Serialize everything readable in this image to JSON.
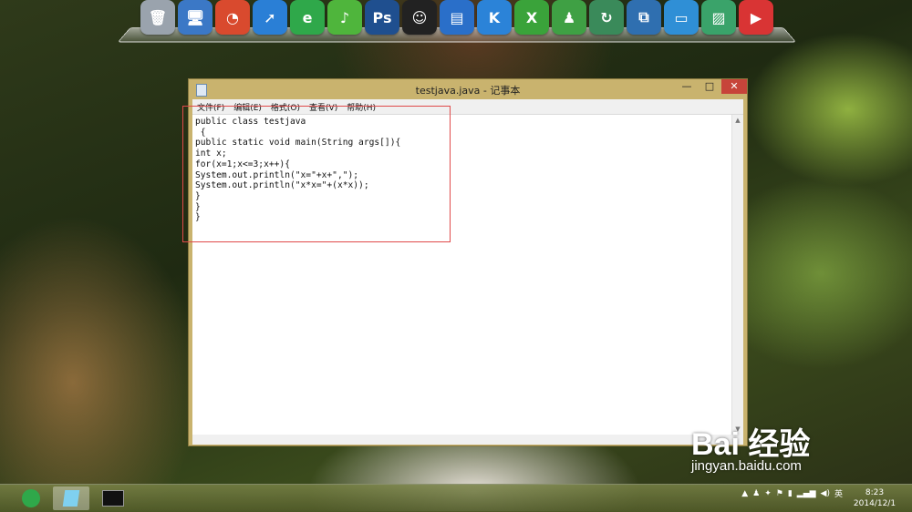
{
  "dock": {
    "icons": [
      {
        "name": "recycle-bin-icon",
        "color": "#9aa3ad",
        "glyph": "🗑"
      },
      {
        "name": "computer-icon",
        "color": "#3b78c6",
        "glyph": "🖥"
      },
      {
        "name": "chrome-icon",
        "color": "#d94a2e",
        "glyph": "◔"
      },
      {
        "name": "xunlei-bird-icon",
        "color": "#2a7fd6",
        "glyph": "➚"
      },
      {
        "name": "ie-browser-icon",
        "color": "#2fa84a",
        "glyph": "e"
      },
      {
        "name": "audio-player-icon",
        "color": "#4fb53c",
        "glyph": "♪"
      },
      {
        "name": "photoshop-icon",
        "color": "#1f4f8f",
        "glyph": "Ps"
      },
      {
        "name": "qq-penguin-icon",
        "color": "#222222",
        "glyph": "☺"
      },
      {
        "name": "video-film-icon",
        "color": "#2a6fc9",
        "glyph": "▤"
      },
      {
        "name": "kugou-music-icon",
        "color": "#2b83d8",
        "glyph": "K"
      },
      {
        "name": "excel-icon",
        "color": "#3aa33a",
        "glyph": "X"
      },
      {
        "name": "user-contacts-icon",
        "color": "#3fa044",
        "glyph": "♟"
      },
      {
        "name": "refresh-sync-icon",
        "color": "#3a8a5a",
        "glyph": "↻"
      },
      {
        "name": "remote-desktop-icon",
        "color": "#2f6fb0",
        "glyph": "⧉"
      },
      {
        "name": "document-icon",
        "color": "#2f8fd6",
        "glyph": "▭"
      },
      {
        "name": "picture-icon",
        "color": "#3aa36a",
        "glyph": "▨"
      },
      {
        "name": "video-player-icon",
        "color": "#d93434",
        "glyph": "▶"
      }
    ]
  },
  "window": {
    "title": "testjava.java - 记事本",
    "min_glyph": "—",
    "max_glyph": "□",
    "close_glyph": "✕",
    "menu": [
      "文件(F)",
      "编辑(E)",
      "格式(O)",
      "查看(V)",
      "帮助(H)"
    ],
    "content": "public class testjava\n {\npublic static void main(String args[]){\nint x;\nfor(x=1;x<=3;x++){\nSystem.out.println(\"x=\"+x+\",\");\nSystem.out.println(\"x*x=\"+(x*x));\n}\n}\n}"
  },
  "taskbar": {
    "tray_lang": "英",
    "time": "8:23",
    "date": "2014/12/1"
  },
  "watermark": {
    "brand": "Bai 经验",
    "url": "jingyan.baidu.com"
  }
}
